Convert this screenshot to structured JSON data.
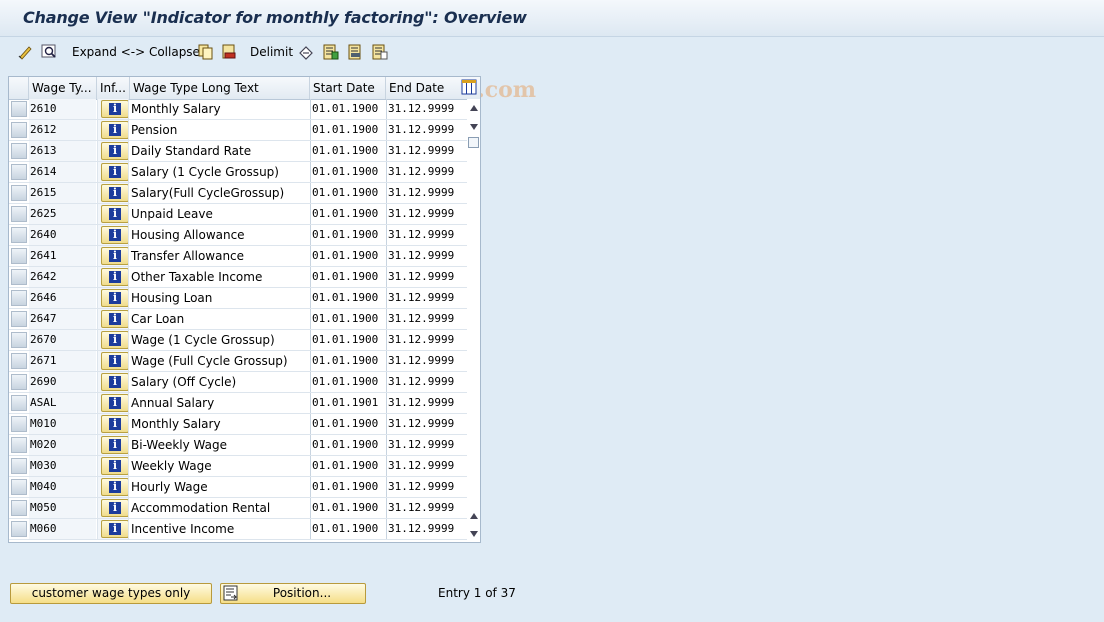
{
  "window": {
    "title": "Change View \"Indicator for monthly factoring\": Overview"
  },
  "toolbar": {
    "expand_collapse_label": "Expand <-> Collapse",
    "delimit_label": "Delimit",
    "watermark": "©www.tutorialkart.com"
  },
  "table": {
    "columns": [
      "Wage Ty...",
      "Inf...",
      "Wage Type Long Text",
      "Start Date",
      "End Date"
    ],
    "rows": [
      {
        "code": "2610",
        "text": "Monthly Salary",
        "start": "01.01.1900",
        "end": "31.12.9999"
      },
      {
        "code": "2612",
        "text": "Pension",
        "start": "01.01.1900",
        "end": "31.12.9999"
      },
      {
        "code": "2613",
        "text": "Daily Standard Rate",
        "start": "01.01.1900",
        "end": "31.12.9999"
      },
      {
        "code": "2614",
        "text": "Salary (1 Cycle Grossup)",
        "start": "01.01.1900",
        "end": "31.12.9999"
      },
      {
        "code": "2615",
        "text": "Salary(Full CycleGrossup)",
        "start": "01.01.1900",
        "end": "31.12.9999"
      },
      {
        "code": "2625",
        "text": "Unpaid Leave",
        "start": "01.01.1900",
        "end": "31.12.9999"
      },
      {
        "code": "2640",
        "text": "Housing Allowance",
        "start": "01.01.1900",
        "end": "31.12.9999"
      },
      {
        "code": "2641",
        "text": "Transfer Allowance",
        "start": "01.01.1900",
        "end": "31.12.9999"
      },
      {
        "code": "2642",
        "text": "Other Taxable Income",
        "start": "01.01.1900",
        "end": "31.12.9999"
      },
      {
        "code": "2646",
        "text": "Housing Loan",
        "start": "01.01.1900",
        "end": "31.12.9999"
      },
      {
        "code": "2647",
        "text": "Car Loan",
        "start": "01.01.1900",
        "end": "31.12.9999"
      },
      {
        "code": "2670",
        "text": "Wage (1 Cycle Grossup)",
        "start": "01.01.1900",
        "end": "31.12.9999"
      },
      {
        "code": "2671",
        "text": "Wage (Full Cycle Grossup)",
        "start": "01.01.1900",
        "end": "31.12.9999"
      },
      {
        "code": "2690",
        "text": "Salary (Off Cycle)",
        "start": "01.01.1900",
        "end": "31.12.9999"
      },
      {
        "code": "ASAL",
        "text": "Annual Salary",
        "start": "01.01.1901",
        "end": "31.12.9999"
      },
      {
        "code": "M010",
        "text": "Monthly Salary",
        "start": "01.01.1900",
        "end": "31.12.9999"
      },
      {
        "code": "M020",
        "text": "Bi-Weekly Wage",
        "start": "01.01.1900",
        "end": "31.12.9999"
      },
      {
        "code": "M030",
        "text": "Weekly Wage",
        "start": "01.01.1900",
        "end": "31.12.9999"
      },
      {
        "code": "M040",
        "text": "Hourly Wage",
        "start": "01.01.1900",
        "end": "31.12.9999"
      },
      {
        "code": "M050",
        "text": "Accommodation Rental",
        "start": "01.01.1900",
        "end": "31.12.9999"
      },
      {
        "code": "M060",
        "text": "Incentive Income",
        "start": "01.01.1900",
        "end": "31.12.9999"
      }
    ]
  },
  "footer": {
    "customer_button": "customer wage types only",
    "position_button": "Position...",
    "entry_text": "Entry 1 of 37"
  }
}
